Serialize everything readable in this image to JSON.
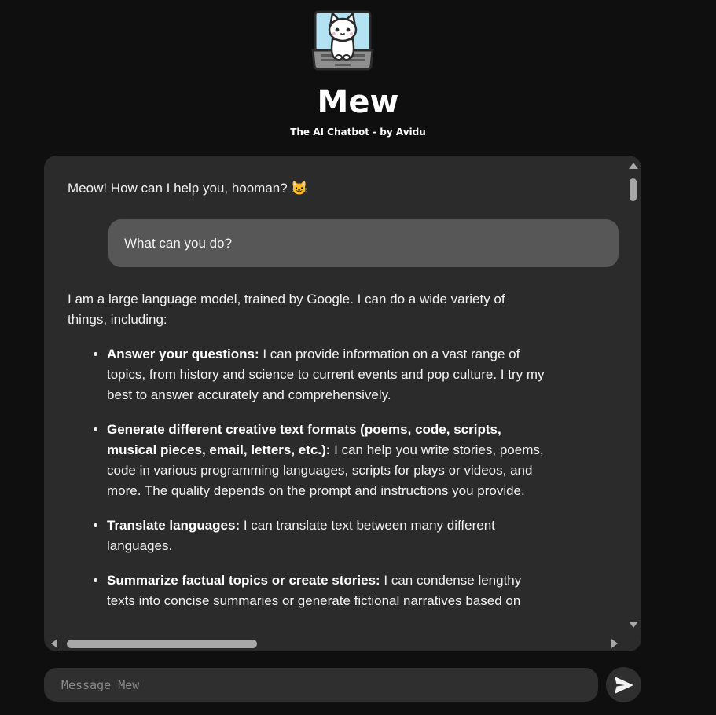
{
  "app": {
    "title": "Mew",
    "subtitle": "The AI Chatbot - by Avidu",
    "logo_icon": "cat-laptop-icon"
  },
  "chat": {
    "greeting": "Meow! How can I help you, hooman? 😺",
    "user_message": "What can you do?",
    "reply_intro": "I am a large language model, trained by Google. I can do a wide variety of things, including:",
    "capabilities": [
      {
        "title": "Answer your questions:",
        "text": " I can provide information on a vast range of topics, from history and science to current events and pop culture. I try my best to answer accurately and comprehensively."
      },
      {
        "title": "Generate different creative text formats (poems, code, scripts, musical pieces, email, letters, etc.):",
        "text": " I can help you write stories, poems, code in various programming languages, scripts for plays or videos, and more. The quality depends on the prompt and instructions you provide."
      },
      {
        "title": "Translate languages:",
        "text": " I can translate text between many different languages."
      },
      {
        "title": "Summarize factual topics or create stories:",
        "text": " I can condense lengthy texts into concise summaries or generate fictional narratives based on"
      }
    ]
  },
  "input": {
    "placeholder": "Message Mew",
    "value": "",
    "send_icon": "send-icon"
  },
  "colors": {
    "background": "#0f0f0f",
    "panel": "#2b2b2b",
    "user_bubble": "#575757",
    "input": "#2f2f2f",
    "scrollbar": "#a8a8a8"
  }
}
